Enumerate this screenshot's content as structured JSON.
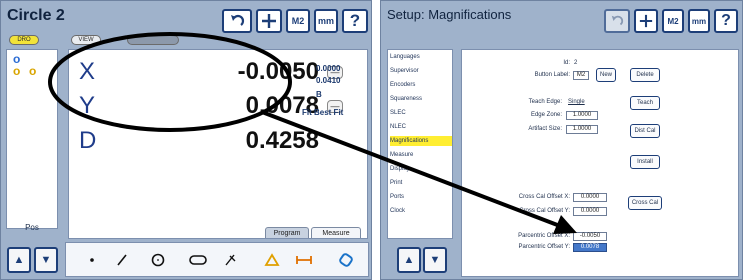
{
  "left_panel": {
    "title": "Circle 2",
    "toolbar": {
      "units_m2": "M2",
      "units_mm": "mm",
      "help": "?"
    },
    "modes": {
      "dro": "DRO",
      "view": "VIEW",
      "third": ""
    },
    "pos_label": "Pos",
    "dro": {
      "axes": [
        {
          "axis": "X",
          "value": "-0.0050"
        },
        {
          "axis": "Y",
          "value": "0.0078"
        },
        {
          "axis": "D",
          "value": "0.4258"
        }
      ],
      "side_values": [
        "0.0000",
        "0.0410"
      ],
      "side_b": "B",
      "fit_label": "Fit Best Fit"
    },
    "tabs": {
      "program": "Program",
      "measure": "Measure"
    }
  },
  "right_panel": {
    "title": "Setup: Magnifications",
    "toolbar": {
      "units_m2": "M2",
      "units_mm": "mm",
      "help": "?"
    },
    "menu": [
      "Languages",
      "Supervisor",
      "Encoders",
      "Squareness",
      "SLEC",
      "NLEC",
      "Magnifications",
      "Measure",
      "Display",
      "Print",
      "Ports",
      "Clock"
    ],
    "menu_selected_index": 6,
    "form": {
      "id_label": "Id:",
      "id_value": "2",
      "button_label_label": "Button Label:",
      "button_label_value": "M2",
      "new_button": "New",
      "delete_button": "Delete",
      "teach_edge_label": "Teach Edge:",
      "teach_edge_value": "Single",
      "teach_button": "Teach",
      "edge_zone_label": "Edge Zone:",
      "edge_zone_value": "1.0000",
      "artifact_size_label": "Artifact Size:",
      "artifact_size_value": "1.0000",
      "dist_cal_button": "Dist Cal",
      "install_button": "Install",
      "cross_cal_offset_x_label": "Cross Cal Offset X:",
      "cross_cal_offset_x_value": "0.0000",
      "cross_cal_offset_y_label": "Cross Cal Offset Y:",
      "cross_cal_offset_y_value": "0.0000",
      "cross_cal_button": "Cross Cal",
      "parcentric_x_label": "Parcentric Offset X:",
      "parcentric_x_value": "-0.0050",
      "parcentric_y_label": "Parcentric Offset Y:",
      "parcentric_y_value": "0.0078"
    }
  },
  "colors": {
    "panel_bg": "#9fb2cb",
    "brand_blue": "#1d3e78",
    "highlight_yellow": "#ffee32",
    "selected_field": "#4478c9"
  }
}
